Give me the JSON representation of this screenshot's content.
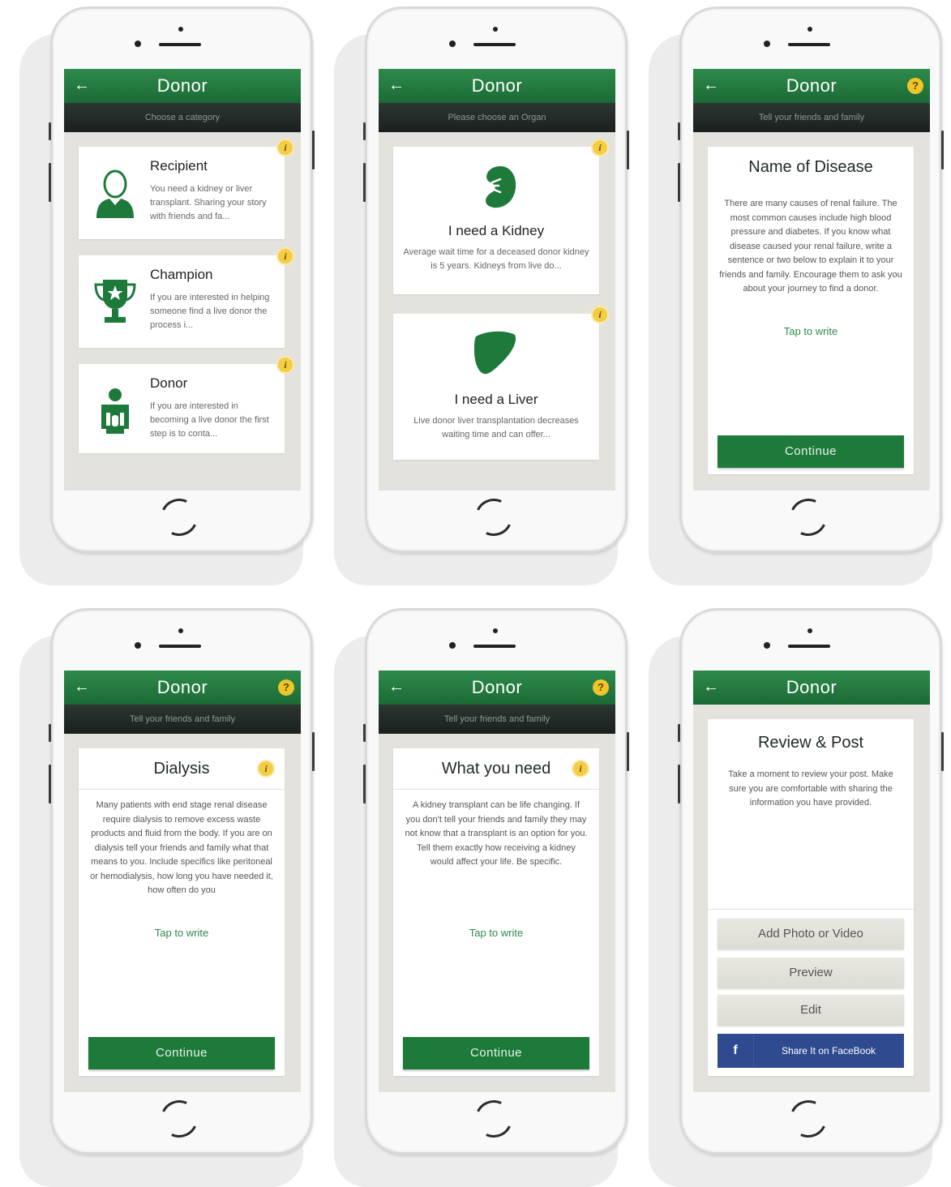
{
  "screens": [
    {
      "header_title": "Donor",
      "subtitle": "Choose a category",
      "categories": [
        {
          "title": "Recipient",
          "description": "You need a kidney or liver transplant. Sharing your story with friends and fa..."
        },
        {
          "title": "Champion",
          "description": "If you are interested in helping someone find a live donor the process i..."
        },
        {
          "title": "Donor",
          "description": "If you are interested in becoming a live donor the first step is to conta..."
        }
      ]
    },
    {
      "header_title": "Donor",
      "subtitle": "Please choose an Organ",
      "organs": [
        {
          "title": "I need a Kidney",
          "description": "Average wait time for a deceased donor kidney is 5 years. Kidneys from live do..."
        },
        {
          "title": "I need a Liver",
          "description": "Live donor liver transplantation decreases waiting time and can offer..."
        }
      ]
    },
    {
      "header_title": "Donor",
      "subtitle": "Tell your friends and family",
      "card_title": "Name of Disease",
      "body": "There are many causes of renal failure. The most common causes include high blood pressure and diabetes. If you know what disease caused your renal failure, write a sentence or two below to explain it to your friends and family. Encourage them to ask you about your journey to find a donor.",
      "tap_label": "Tap to write",
      "continue_label": "Continue"
    },
    {
      "header_title": "Donor",
      "subtitle": "Tell your friends and family",
      "card_title": "Dialysis",
      "body": "Many patients with end stage renal disease require dialysis to remove excess waste products and fluid from the body. If you are on dialysis tell your friends and family what that means to you. Include specifics like peritoneal or hemodialysis, how long you have needed it, how often do you",
      "tap_label": "Tap to write",
      "continue_label": "Continue"
    },
    {
      "header_title": "Donor",
      "subtitle": "Tell your friends and family",
      "card_title": "What you need",
      "body": "A kidney transplant can be life changing. If you don't tell your friends and family they may not know that a transplant is an option for you. Tell them exactly how receiving a kidney would affect your life. Be specific.",
      "tap_label": "Tap to write",
      "continue_label": "Continue"
    },
    {
      "header_title": "Donor",
      "card_title": "Review & Post",
      "body": "Take a moment to review your post. Make sure you are comfortable with sharing the information you have provided.",
      "add_media_label": "Add Photo or Video",
      "preview_label": "Preview",
      "edit_label": "Edit",
      "share_label": "Share It on FaceBook"
    }
  ],
  "icons": {
    "back": "←",
    "help": "?",
    "info": "i",
    "facebook": "f"
  },
  "colors": {
    "brand_green": "#1d7a3a",
    "header_dark": "#1a201d",
    "info_yellow": "#f3cd46",
    "facebook_blue": "#2f4a8f"
  }
}
